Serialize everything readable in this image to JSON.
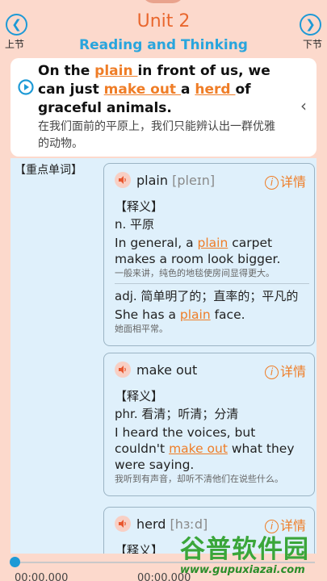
{
  "header": {
    "unit_title": "Unit 2",
    "subtitle": "Reading and Thinking",
    "prev_label": "上节",
    "next_label": "下节"
  },
  "sentence": {
    "parts": [
      {
        "text": "On the ",
        "kw": false
      },
      {
        "text": "plain ",
        "kw": true
      },
      {
        "text": "in front of us, we can just ",
        "kw": false
      },
      {
        "text": "make out ",
        "kw": true
      },
      {
        "text": "a ",
        "kw": false
      },
      {
        "text": "herd ",
        "kw": true
      },
      {
        "text": "of graceful animals.",
        "kw": false
      }
    ],
    "translation": "在我们面前的平原上，我们只能辨认出一群优雅的动物。"
  },
  "section_label": "【重点单词】",
  "detail_label": "详情",
  "meaning_label": "【释义】",
  "words": [
    {
      "headword": "plain",
      "phonetic": "[pleɪn]",
      "senses": [
        {
          "def": "n. 平原",
          "example": [
            {
              "text": "In general, a ",
              "kw": false
            },
            {
              "text": "plain",
              "kw": true
            },
            {
              "text": " carpet makes a room look bigger.",
              "kw": false
            }
          ],
          "example_zh": "一般来讲，纯色的地毯使房间显得更大。"
        },
        {
          "def": "adj. 简单明了的；直率的；平凡的",
          "example": [
            {
              "text": "She has a ",
              "kw": false
            },
            {
              "text": "plain",
              "kw": true
            },
            {
              "text": " face.",
              "kw": false
            }
          ],
          "example_zh": "她面相平常。"
        }
      ]
    },
    {
      "headword": "make out",
      "phonetic": "",
      "senses": [
        {
          "def": "phr. 看清；听清；分清",
          "example": [
            {
              "text": "I heard the voices, but couldn't ",
              "kw": false
            },
            {
              "text": "make out",
              "kw": true
            },
            {
              "text": " what they were saying.",
              "kw": false
            }
          ],
          "example_zh": "我听到有声音，却听不清他们在说些什么。"
        }
      ]
    },
    {
      "headword": "herd",
      "phonetic": "[hɜːd]",
      "senses": []
    }
  ],
  "player": {
    "current_time": "00:00.000",
    "total_time": "00:00.000",
    "progress": 0
  },
  "watermark": {
    "main": "谷普软件园",
    "url": "www.gupuxiazai.com"
  }
}
